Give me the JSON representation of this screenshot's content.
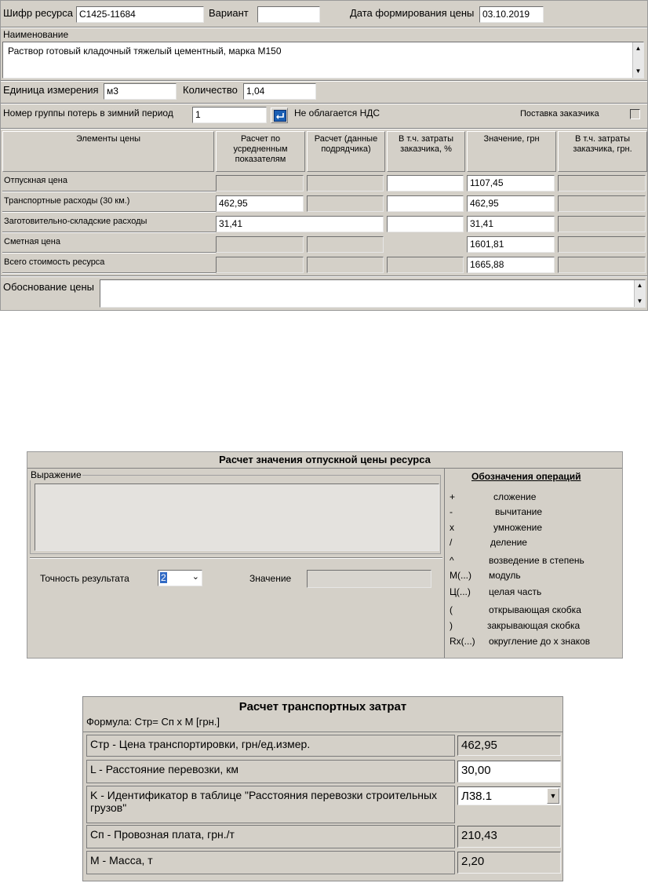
{
  "form_resource": {
    "code_label": "Шифр ресурса",
    "code_value": "С1425-11684",
    "variant_label": "Вариант",
    "variant_value": "",
    "date_label": "Дата формирования цены",
    "date_value": "03.10.2019",
    "name_label": "Наименование",
    "name_value": "Раствор готовый кладочный тяжелый цементный, марка М150",
    "unit_label": "Единица измерения",
    "unit_value": "м3",
    "qty_label": "Количество",
    "qty_value": "1,04",
    "winter_group_label": "Номер группы потерь в зимний период",
    "winter_group_value": "1",
    "no_vat_label": "Не облагается НДС",
    "customer_supply_label": "Поставка заказчика",
    "table": {
      "headers": [
        "Элементы цены",
        "Расчет по усредненным показателям",
        "Расчет (данные подрядчика)",
        "В т.ч. затраты заказчика, %",
        "Значение, грн",
        "В т.ч. затраты заказчика, грн."
      ],
      "rows": [
        {
          "label": "Отпускная цена",
          "avg": "",
          "contractor": "",
          "customer_pct": "",
          "value": "1107,45",
          "customer_uah": ""
        },
        {
          "label": "Транспортные расходы (30 км.)",
          "avg": "462,95",
          "contractor": "",
          "customer_pct": "",
          "value": "462,95",
          "customer_uah": ""
        },
        {
          "label": "Заготовительно-складские расходы",
          "avg": "31,41",
          "contractor": "",
          "customer_pct": "",
          "value": "31,41",
          "customer_uah": ""
        },
        {
          "label": "Сметная цена",
          "avg": "",
          "contractor": "",
          "customer_pct": "",
          "value": "1601,81",
          "customer_uah": ""
        },
        {
          "label": "Всего стоимость ресурса",
          "avg": "",
          "contractor": "",
          "customer_pct": "",
          "value": "1665,88",
          "customer_uah": ""
        }
      ]
    },
    "justification_label": "Обоснование цены",
    "justification_value": ""
  },
  "form_release_price": {
    "title": "Расчет значения отпускной цены ресурса",
    "expression_label": "Выражение",
    "expression_value": "",
    "precision_label": "Точность результата",
    "precision_value": "2",
    "value_label": "Значение",
    "value_value": "",
    "ops_title": "Обозначения операций",
    "ops": [
      {
        "sym": "+",
        "desc": "сложение"
      },
      {
        "sym": "-",
        "desc": "вычитание"
      },
      {
        "sym": "x",
        "desc": "умножение"
      },
      {
        "sym": "/",
        "desc": "деление"
      },
      {
        "sym": "^",
        "desc": "возведение в степень"
      },
      {
        "sym": "М(...)",
        "desc": "модуль"
      },
      {
        "sym": "Ц(...)",
        "desc": "целая часть"
      },
      {
        "sym": "(",
        "desc": "открывающая скобка"
      },
      {
        "sym": ")",
        "desc": "закрывающая скобка"
      },
      {
        "sym": "Rx(...)",
        "desc": "округление до х знаков"
      }
    ]
  },
  "form_transport": {
    "title": "Расчет транспортных затрат",
    "formula": "Формула: Стр= Сп х М [грн.]",
    "rows": [
      {
        "label": "Стр - Цена транспортировки, грн/ед.измер.",
        "value": "462,95"
      },
      {
        "label": "L -  Расстояние перевозки, км",
        "value": "30,00"
      },
      {
        "label": "K - Идентификатор в таблице \"Расстояния перевозки строительных грузов\"",
        "value": "Л38.1"
      },
      {
        "label": "Сп - Провозная плата, грн./т",
        "value": "210,43"
      },
      {
        "label": "М - Масса, т",
        "value": "2,20"
      }
    ]
  }
}
